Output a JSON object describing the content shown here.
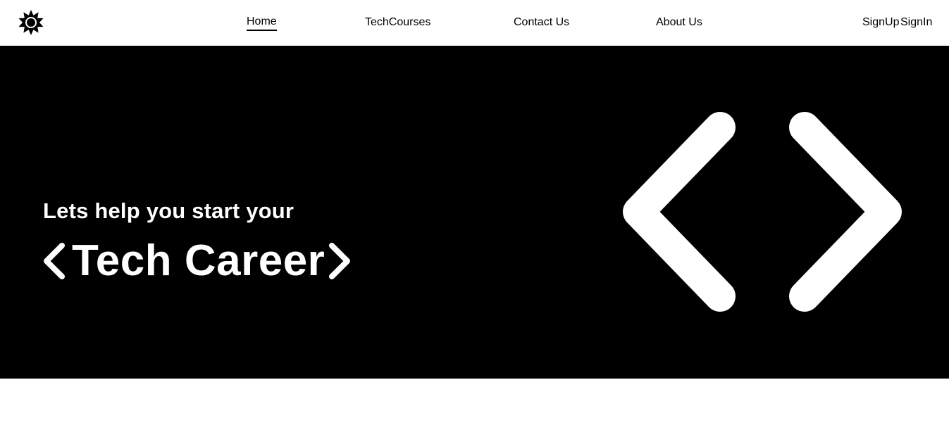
{
  "nav": {
    "logo_icon": "gear-sun-icon",
    "links": [
      {
        "label": "Home",
        "active": true
      },
      {
        "label": "TechCourses",
        "active": false
      },
      {
        "label": "Contact Us",
        "active": false
      },
      {
        "label": "About Us",
        "active": false
      }
    ],
    "signup_label": "SignUp",
    "signin_label": "SignIn"
  },
  "hero": {
    "subtitle": "Lets help you start your",
    "title": "Tech Career",
    "title_icons": [
      "chevron-left-icon",
      "chevron-right-icon"
    ],
    "graphic_icon": "code-brackets-icon",
    "background_color": "#000000",
    "text_color": "#ffffff"
  }
}
